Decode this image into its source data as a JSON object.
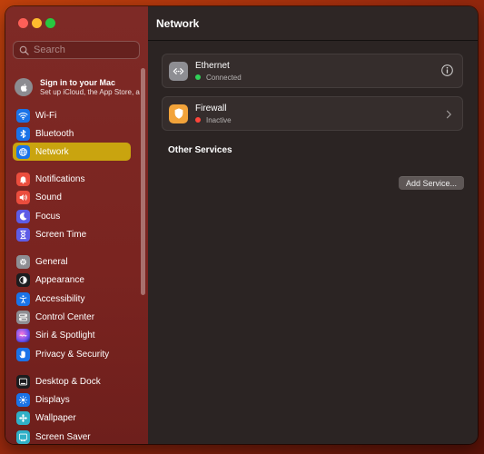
{
  "search": {
    "placeholder": "Search"
  },
  "apple_account": {
    "title": "Sign in to your Mac",
    "subtitle": "Set up iCloud, the App Store, and more."
  },
  "sidebar": {
    "items": [
      {
        "label": "Wi-Fi",
        "icon": "wifi-icon",
        "color": "#1a73e8"
      },
      {
        "label": "Bluetooth",
        "icon": "bluetooth-icon",
        "color": "#1a73e8"
      },
      {
        "label": "Network",
        "icon": "globe-icon",
        "color": "#1a73e8",
        "selected": true
      },
      {
        "label": "Notifications",
        "icon": "bell-icon",
        "color": "#eb4d3d"
      },
      {
        "label": "Sound",
        "icon": "speaker-icon",
        "color": "#eb4d3d"
      },
      {
        "label": "Focus",
        "icon": "moon-icon",
        "color": "#5e5ce6"
      },
      {
        "label": "Screen Time",
        "icon": "hourglass-icon",
        "color": "#5e5ce6"
      },
      {
        "label": "General",
        "icon": "gear-icon",
        "color": "#8e8e93"
      },
      {
        "label": "Appearance",
        "icon": "appearance-icon",
        "color": "#1c1c1e"
      },
      {
        "label": "Accessibility",
        "icon": "accessibility-icon",
        "color": "#1a73e8"
      },
      {
        "label": "Control Center",
        "icon": "control-center-icon",
        "color": "#8e8e93"
      },
      {
        "label": "Siri & Spotlight",
        "icon": "siri-icon",
        "color": "#b545d8"
      },
      {
        "label": "Privacy & Security",
        "icon": "hand-icon",
        "color": "#1a73e8"
      },
      {
        "label": "Desktop & Dock",
        "icon": "dock-icon",
        "color": "#1c1c1e"
      },
      {
        "label": "Displays",
        "icon": "sun-icon",
        "color": "#1a73e8"
      },
      {
        "label": "Wallpaper",
        "icon": "wallpaper-icon",
        "color": "#30b0c7"
      },
      {
        "label": "Screen Saver",
        "icon": "screen-saver-icon",
        "color": "#30b0c7"
      }
    ]
  },
  "main": {
    "title": "Network",
    "services": [
      {
        "name": "Ethernet",
        "status": "Connected",
        "status_color": "#30d158",
        "icon": "ethernet-icon",
        "icon_color": "#8e8e93",
        "accessory": "info-icon"
      },
      {
        "name": "Firewall",
        "status": "Inactive",
        "status_color": "#ff453a",
        "icon": "shield-icon",
        "icon_color": "#f2a33a",
        "accessory": "chevron-right-icon"
      }
    ],
    "other_services_label": "Other Services",
    "add_service_label": "Add Service..."
  },
  "colors": {
    "selection": "#c9a40f",
    "sidebar_bg": "#7a2420",
    "content_bg": "#2b2423"
  }
}
